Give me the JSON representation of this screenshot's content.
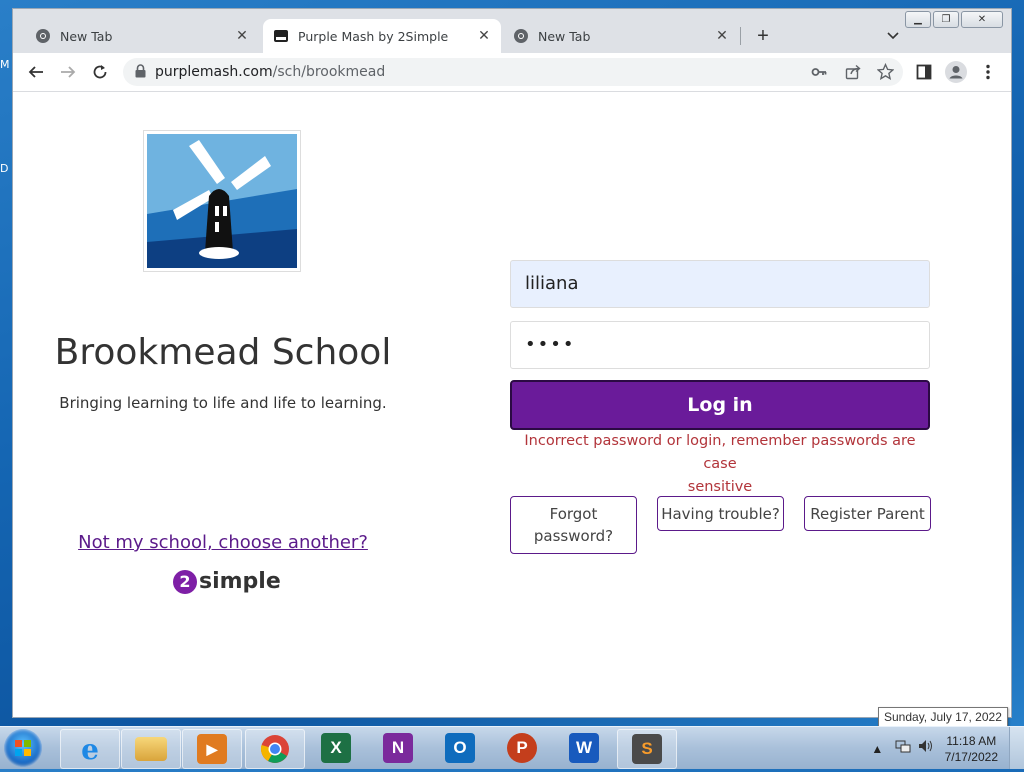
{
  "desktop": {
    "label1": "M",
    "label2": "D"
  },
  "window": {
    "controls": [
      "minimize-icon",
      "restore-icon",
      "close-icon"
    ]
  },
  "tabs": [
    {
      "label": "New Tab",
      "icon": "chrome-icon",
      "active": false
    },
    {
      "label": "Purple Mash by 2Simple",
      "icon": "purple-mash-icon",
      "active": true
    },
    {
      "label": "New Tab",
      "icon": "chrome-icon",
      "active": false
    }
  ],
  "toolbar": {
    "url_host": "purplemash.com",
    "url_path": "/sch/brookmead"
  },
  "page": {
    "school_name": "Brookmead School",
    "tagline": "Bringing learning to life and life to learning.",
    "not_my_school": "Not my school, choose another?",
    "brand_number": "2",
    "brand_word": "simple",
    "username_value": "liliana",
    "password_value": "••••",
    "login_label": "Log in",
    "error_line1": "Incorrect password or login, remember passwords are case",
    "error_line2": "sensitive",
    "forgot_line1": "Forgot",
    "forgot_line2": "password?",
    "trouble_label": "Having trouble?",
    "register_label": "Register Parent"
  },
  "taskbar": {
    "apps": [
      {
        "name": "internet-explorer-icon",
        "letter": "e",
        "color": "#1e88e5"
      },
      {
        "name": "file-explorer-icon",
        "letter": "",
        "color": "#e8b84a"
      },
      {
        "name": "media-player-icon",
        "letter": "▶",
        "color": "#e07b20"
      },
      {
        "name": "chrome-icon",
        "letter": "",
        "color": "#db4437"
      },
      {
        "name": "excel-icon",
        "letter": "X",
        "color": "#1d7044"
      },
      {
        "name": "onenote-icon",
        "letter": "N",
        "color": "#7b2a9c"
      },
      {
        "name": "outlook-icon",
        "letter": "O",
        "color": "#0f6cbd"
      },
      {
        "name": "powerpoint-icon",
        "letter": "P",
        "color": "#c43e1c"
      },
      {
        "name": "word-icon",
        "letter": "W",
        "color": "#185abd"
      },
      {
        "name": "sublime-text-icon",
        "letter": "S",
        "color": "#4a4a4a"
      }
    ],
    "time": "11:18 AM",
    "date": "7/17/2022",
    "tooltip": "Sunday, July 17, 2022"
  }
}
